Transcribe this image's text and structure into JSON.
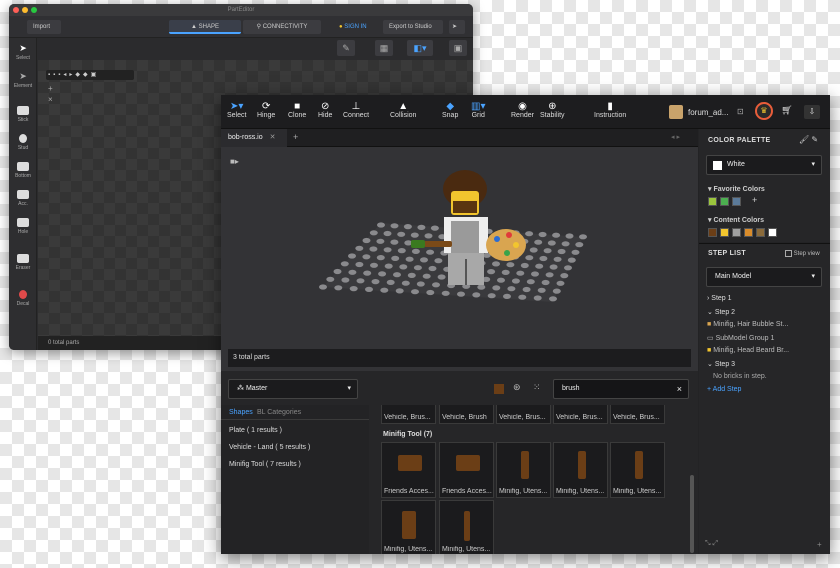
{
  "back_window": {
    "title": "PartEditor",
    "import_label": "Import",
    "tab_shape": "SHAPE",
    "tab_connectivity": "CONNECTIVITY",
    "sign_in": "SIGN IN",
    "export_label": "Export to Studio",
    "tools": [
      "Select",
      "Element",
      "Stick",
      "Stud",
      "Bottom",
      "Acc.",
      "Hole",
      "Eraser",
      "Decal"
    ],
    "status": "0 total parts",
    "plus": "+",
    "close": "×"
  },
  "front_window": {
    "toolbar": {
      "tools": [
        "Select",
        "Hinge",
        "Clone",
        "Hide",
        "Connect",
        "Collision",
        "Snap",
        "Grid",
        "Render",
        "Stability",
        "Instruction"
      ],
      "user": "forum_ad..."
    },
    "tab": {
      "name": "bob-ross.io",
      "close": "✕",
      "add": "+"
    },
    "status": "3 total parts",
    "palette_panel": {
      "title": "COLOR PALETTE",
      "selected_color": "White",
      "favorite_label": "Favorite Colors",
      "content_label": "Content Colors",
      "favorite_add": "+",
      "favorite_colors": [
        "#9bc53d",
        "#4caf50",
        "#5b7a99"
      ],
      "content_colors": [
        "#6b3e16",
        "#f2c52e",
        "#a0a0a0",
        "#d98c2b",
        "#8a6a3a",
        "#ffffff"
      ]
    },
    "step_panel": {
      "title": "STEP LIST",
      "step_view": "Step view",
      "model": "Main Model",
      "items": [
        {
          "text": "Step 1",
          "type": "step",
          "open": false
        },
        {
          "text": "Step 2",
          "type": "step",
          "open": true
        },
        {
          "text": "Minifig, Hair Bubble St...",
          "type": "part"
        },
        {
          "text": "SubModel Group 1",
          "type": "part"
        },
        {
          "text": "Minifig, Head Beard Br...",
          "type": "part"
        },
        {
          "text": "Step 3",
          "type": "step",
          "open": true
        },
        {
          "text": "No bricks in step.",
          "type": "note"
        }
      ],
      "add_step": "+ Add Step"
    },
    "library": {
      "palette_select": "Master",
      "search_value": "brush",
      "search_clear": "×",
      "tabs": [
        "Shapes",
        "BL Categories"
      ],
      "categories": [
        "Plate ( 1 results )",
        "Vehicle - Land ( 5 results )",
        "Minifig Tool ( 7 results )"
      ],
      "top_row_labels": [
        "Vehicle, Brus...",
        "Vehicle, Brush",
        "Vehicle, Brus...",
        "Vehicle, Brus...",
        "Vehicle, Brus..."
      ],
      "group_title": "Minifig Tool (7)",
      "row1_labels": [
        "Friends Acces...",
        "Friends Acces...",
        "Minifig, Utens...",
        "Minifig, Utens...",
        "Minifig, Utens..."
      ],
      "row2_labels": [
        "Minifig, Utens...",
        "Minifig, Utens..."
      ]
    }
  }
}
